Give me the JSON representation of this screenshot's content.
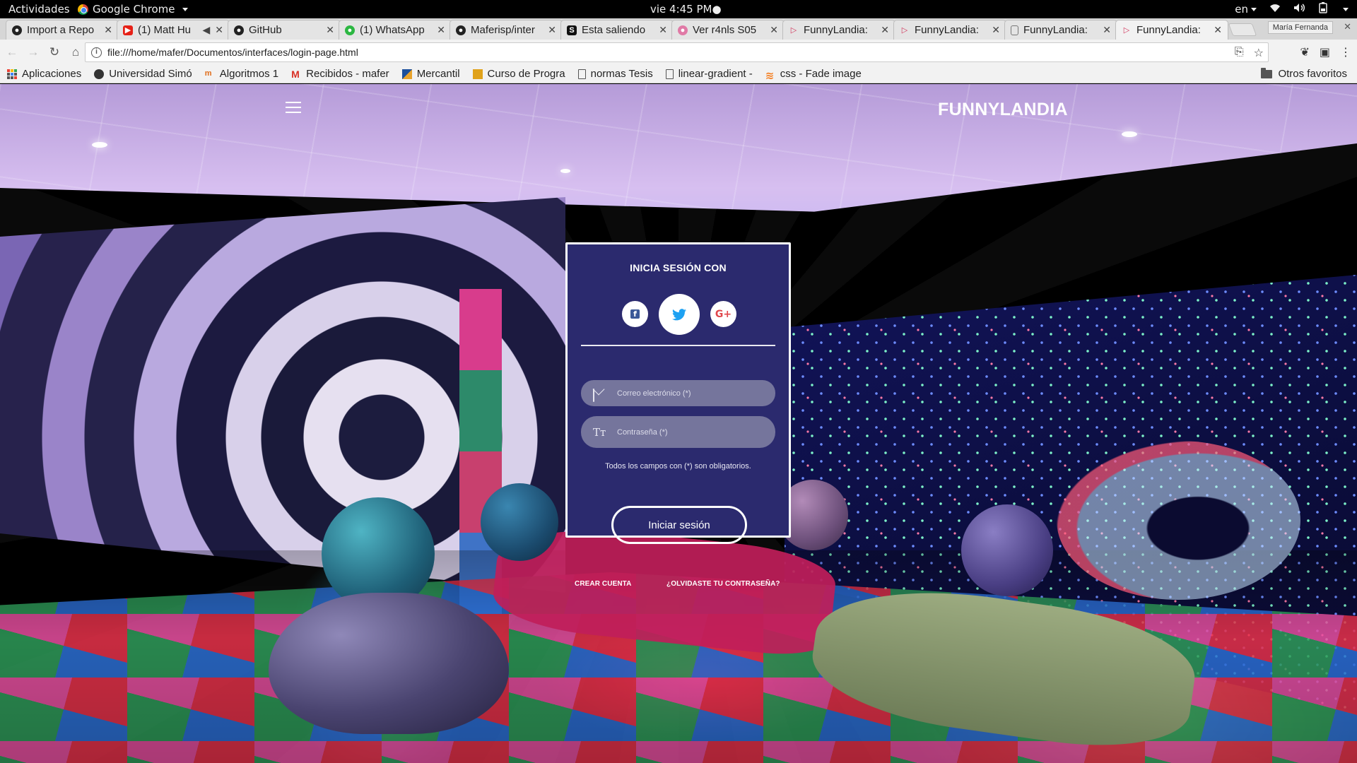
{
  "gnome": {
    "activities": "Actividades",
    "app_name": "Google Chrome",
    "clock": "vie  4:45 PM●",
    "lang": "en"
  },
  "tabs": [
    {
      "label": "Import a Repo",
      "icon": "github-icon",
      "color": "#222222"
    },
    {
      "label": "(1) Matt Hu",
      "icon": "youtube-icon",
      "color": "#e62117",
      "muted": true
    },
    {
      "label": "GitHub",
      "icon": "github-icon",
      "color": "#222222"
    },
    {
      "label": "(1) WhatsApp",
      "icon": "whatsapp-icon",
      "color": "#2cb742"
    },
    {
      "label": "Maferisp/inter",
      "icon": "github-icon",
      "color": "#222222"
    },
    {
      "label": "Esta saliendo",
      "icon": "su-icon",
      "color": "#111111"
    },
    {
      "label": "Ver r4nls S05",
      "icon": "anime-icon",
      "color": "#e07aa6"
    },
    {
      "label": "FunnyLandia:",
      "icon": "funnylandia-icon",
      "color": "#d1345b"
    },
    {
      "label": "FunnyLandia:",
      "icon": "funnylandia-icon",
      "color": "#d1345b"
    },
    {
      "label": "FunnyLandia:",
      "icon": "page-icon",
      "color": "#777777"
    },
    {
      "label": "FunnyLandia:",
      "icon": "funnylandia-icon",
      "color": "#d1345b",
      "active": true
    }
  ],
  "profile_name": "María Fernanda",
  "url": "file:///home/mafer/Documentos/interfaces/login-page.html",
  "bookmarks": [
    {
      "label": "Aplicaciones",
      "icon": "apps-grid-icon"
    },
    {
      "label": "Universidad Simó",
      "icon": "usb-icon"
    },
    {
      "label": "Algoritmos 1",
      "icon": "algoritmos-icon"
    },
    {
      "label": "Recibidos - mafer",
      "icon": "gmail-icon"
    },
    {
      "label": "Mercantil",
      "icon": "mercantil-icon"
    },
    {
      "label": "Curso de Progra",
      "icon": "curso-icon"
    },
    {
      "label": "normas Tesis",
      "icon": "page-icon"
    },
    {
      "label": "linear-gradient -",
      "icon": "page-icon"
    },
    {
      "label": "css - Fade image",
      "icon": "stackoverflow-icon"
    }
  ],
  "other_bookmarks": "Otros favoritos",
  "site": {
    "brand": "FUNNYLANDIA"
  },
  "login": {
    "title": "INICIA SESIÓN CON",
    "email_placeholder": "Correo electrónico (*)",
    "password_placeholder": "Contraseña (*)",
    "required_note": "Todos los campos con (*) son obligatorios.",
    "submit": "Iniciar sesión",
    "create_account": "CREAR CUENTA",
    "forgot_password": "¿OLVIDASTE TU CONTRASEÑA?",
    "social": [
      "facebook-icon",
      "twitter-icon",
      "google-plus-icon"
    ]
  },
  "colors": {
    "card_bg": "#2b2a6e",
    "field_bg": "#75759c",
    "twitter_blue": "#1da1f2",
    "google_red": "#e0474c",
    "facebook_blue": "#3b5998"
  }
}
